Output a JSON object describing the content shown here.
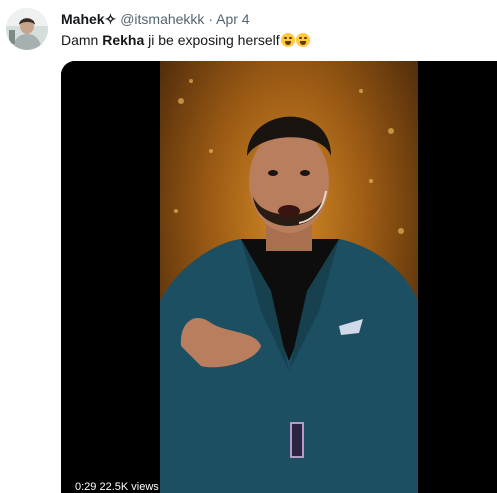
{
  "tweet": {
    "author_name": "Mahek",
    "author_symbol": "✧",
    "author_handle": "@itsmahekkk",
    "separator": "·",
    "date": "Apr 4",
    "text_before": "Damn ",
    "text_bold": "Rekha",
    "text_after": " ji be exposing herself"
  },
  "media": {
    "video_time": "0:29",
    "view_count": "22.5K views",
    "colors": {
      "background": "#000000",
      "stage_glow": "#b8701a",
      "suit": "#1d4f63",
      "shirt": "#0d0d0d",
      "skin": "#b87e5d"
    }
  },
  "icons": [
    "avatar-photo",
    "loudly-crying-face-emoji",
    "face-with-tears-of-joy-emoji"
  ]
}
